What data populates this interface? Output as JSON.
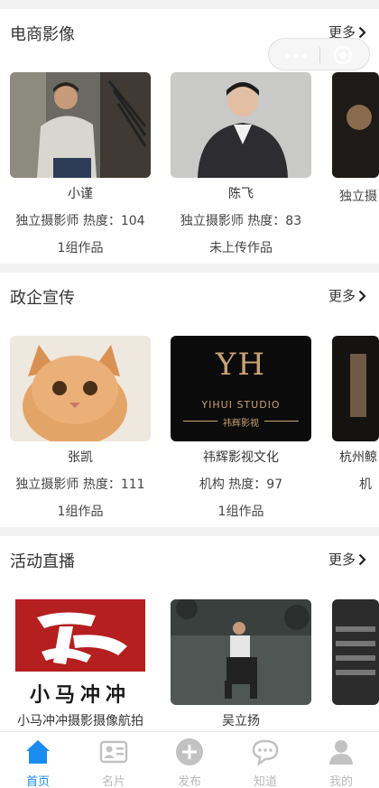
{
  "sections": [
    {
      "title": "电商影像",
      "more": "更多",
      "cards": [
        {
          "name": "小谨",
          "meta": "独立摄影师  热度：104",
          "works": "1组作品"
        },
        {
          "name": "陈飞",
          "meta": "独立摄影师  热度：83",
          "works": "未上传作品"
        },
        {
          "name": "",
          "meta": "独立摄",
          "works": ""
        }
      ]
    },
    {
      "title": "政企宣传",
      "more": "更多",
      "cards": [
        {
          "name": "张凯",
          "meta": "独立摄影师  热度：111",
          "works": "1组作品"
        },
        {
          "name": "祎辉影视文化",
          "meta": "机构  热度：97",
          "works": "1组作品",
          "logo_top": "YH",
          "logo_mid": "YIHUI STUDIO",
          "logo_bottom": "祎辉影视"
        },
        {
          "name": "杭州鲸",
          "meta": "机",
          "works": ""
        }
      ]
    },
    {
      "title": "活动直播",
      "more": "更多",
      "cards": [
        {
          "name": "小马冲冲摄影摄像航拍",
          "meta": "",
          "works": "",
          "logo_text": "小马冲冲"
        },
        {
          "name": "吴立扬",
          "meta": "",
          "works": ""
        },
        {
          "name": "",
          "meta": "",
          "works": ""
        }
      ]
    }
  ],
  "tabs": [
    {
      "label": "首页",
      "icon": "home-icon",
      "active": true
    },
    {
      "label": "名片",
      "icon": "card-icon",
      "active": false
    },
    {
      "label": "发布",
      "icon": "plus-icon",
      "active": false
    },
    {
      "label": "知道",
      "icon": "chat-icon",
      "active": false
    },
    {
      "label": "我的",
      "icon": "user-icon",
      "active": false
    }
  ],
  "colors": {
    "accent": "#1c8cf0",
    "tab_inactive": "#b9b9b9",
    "background": "#f2f2f2"
  }
}
